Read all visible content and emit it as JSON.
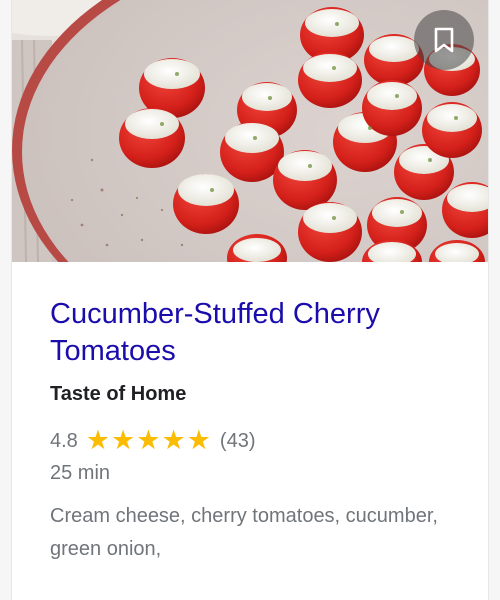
{
  "recipe": {
    "title": "Cucumber-Stuffed Cherry Tomatoes",
    "source": "Taste of Home",
    "rating": "4.8",
    "stars_filled": 5,
    "stars_total": 5,
    "review_count": "(43)",
    "time": "25 min",
    "ingredients": "Cream cheese, cherry tomatoes, cucumber, green onion,"
  },
  "image": {
    "bookmark_icon": "bookmark-icon"
  },
  "colors": {
    "title_link": "#1a0dab",
    "star": "#fbbc04",
    "secondary_text": "#70757a"
  }
}
